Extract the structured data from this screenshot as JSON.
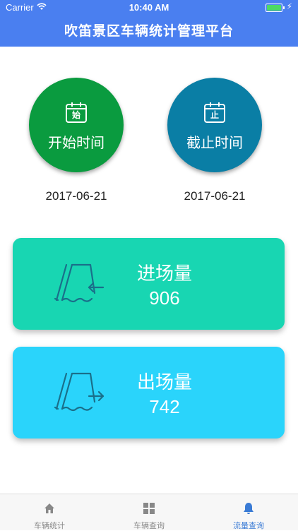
{
  "status": {
    "carrier": "Carrier",
    "time": "10:40 AM"
  },
  "header": {
    "title": "吹笛景区车辆统计管理平台"
  },
  "start": {
    "icon_char": "始",
    "label": "开始时间",
    "date": "2017-06-21"
  },
  "end": {
    "icon_char": "止",
    "label": "截止时间",
    "date": "2017-06-21"
  },
  "cards": {
    "in": {
      "label": "进场量",
      "value": "906"
    },
    "out": {
      "label": "出场量",
      "value": "742"
    }
  },
  "tabs": [
    {
      "label": "车辆统计",
      "icon": "home-icon"
    },
    {
      "label": "车辆查询",
      "icon": "grid-icon"
    },
    {
      "label": "流量查询",
      "icon": "bell-icon",
      "active": true
    }
  ],
  "colors": {
    "header": "#4a7ff0",
    "start_circle": "#0a9b3f",
    "end_circle": "#0a7ea5",
    "in_card": "#18d6b2",
    "out_card": "#2ad4fb",
    "tab_active": "#3a7bd5"
  }
}
